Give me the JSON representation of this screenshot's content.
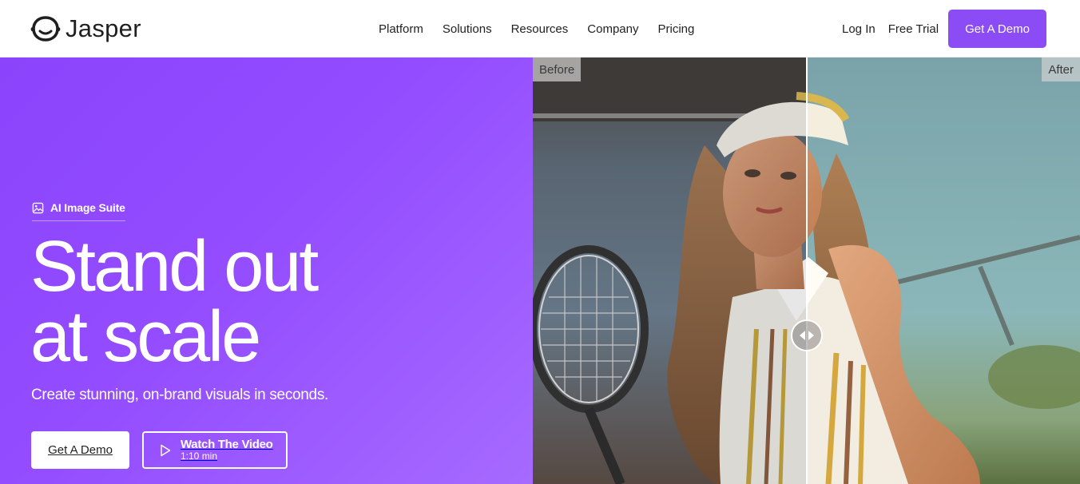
{
  "brand": {
    "name": "Jasper",
    "accent": "#8b4cf6",
    "hero_bg": "#9148ff"
  },
  "nav": {
    "items": [
      "Platform",
      "Solutions",
      "Resources",
      "Company",
      "Pricing"
    ],
    "login": "Log In",
    "free_trial": "Free Trial",
    "demo": "Get A Demo"
  },
  "hero": {
    "badge_icon": "image-icon",
    "badge": "AI Image Suite",
    "headline_line1": "Stand out",
    "headline_line2": "at scale",
    "subtitle": "Create stunning, on-brand visuals in seconds.",
    "cta_primary": "Get A Demo",
    "cta_video_title": "Watch The Video",
    "cta_video_duration": "1:10 min",
    "cta_video_icon": "play-icon"
  },
  "comparison": {
    "before_label": "Before",
    "after_label": "After",
    "slider_position": 0.5,
    "handle_icon": "drag-arrows-icon"
  }
}
